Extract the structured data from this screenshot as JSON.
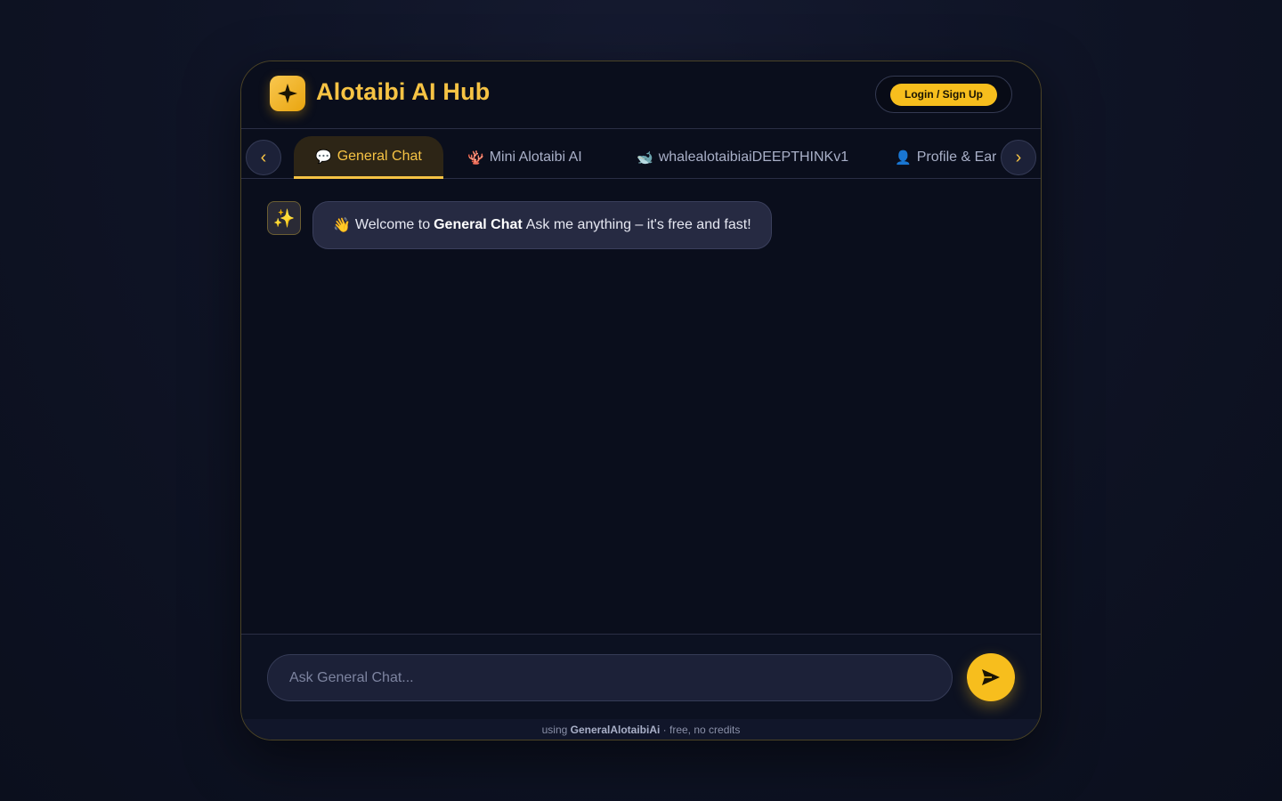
{
  "header": {
    "brand": "Alotaibi AI Hub",
    "logo_icon": "sparkle-icon",
    "auth_label": "Login / Sign Up"
  },
  "tabs": {
    "prev_label": "‹",
    "next_label": "›",
    "items": [
      {
        "emoji": "💬",
        "label": "General Chat",
        "active": true
      },
      {
        "emoji": "🪸",
        "label": "Mini Alotaibi AI",
        "active": false
      },
      {
        "emoji": "🐋",
        "label": "whalealotaibiaiDEEPTHINKv1",
        "active": false
      },
      {
        "emoji": "👤",
        "label": "Profile & Earn",
        "active": false
      }
    ]
  },
  "chat": {
    "avatar_emoji": "✨",
    "welcome": {
      "emoji": "👋",
      "prefix": "Welcome to",
      "bold": "General Chat",
      "suffix": "Ask me anything – it's free and fast!"
    }
  },
  "composer": {
    "placeholder": "Ask General Chat...",
    "value": "",
    "send_icon": "send-icon"
  },
  "footer": {
    "prefix": "using",
    "model": "GeneralAlotaibiAi",
    "suffix": "· free, no credits"
  },
  "colors": {
    "accent": "#f6c344",
    "button": "#f7be1d",
    "panel": "#0a0e1c",
    "bubble": "#262a42"
  }
}
